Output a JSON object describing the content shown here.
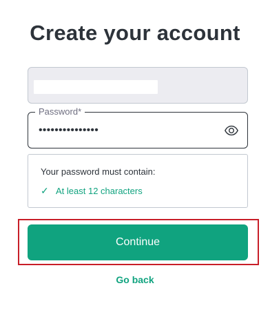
{
  "page": {
    "title": "Create your account"
  },
  "email": {
    "value": ""
  },
  "password": {
    "label": "Password*",
    "value": "•••••••••••••••",
    "visibility_icon": "eye-icon"
  },
  "requirements": {
    "heading": "Your password must contain:",
    "items": [
      {
        "check": "✓",
        "text": "At least 12 characters",
        "status": "met"
      }
    ]
  },
  "actions": {
    "continue_label": "Continue",
    "go_back_label": "Go back"
  },
  "colors": {
    "accent": "#10a37f",
    "highlight": "#c81e28",
    "text": "#2d333a"
  }
}
